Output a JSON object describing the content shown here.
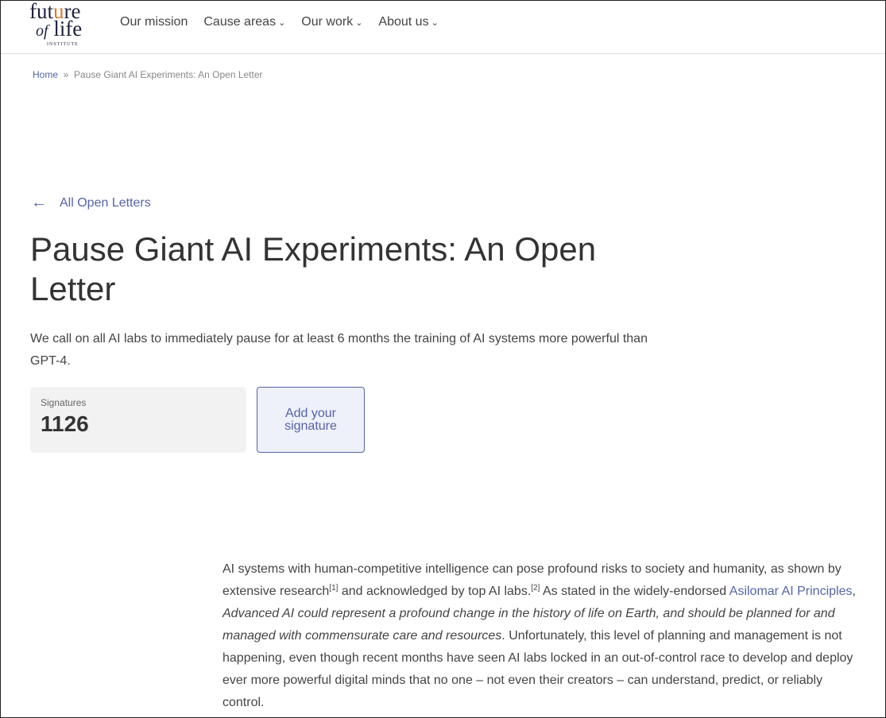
{
  "logo": {
    "line1": "future",
    "line2_of": "of",
    "line2": "life",
    "line3": "INSTITUTE"
  },
  "nav": {
    "items": [
      {
        "label": "Our mission"
      },
      {
        "label": "Cause areas",
        "dropdown": true
      },
      {
        "label": "Our work",
        "dropdown": true
      },
      {
        "label": "About us",
        "dropdown": true
      }
    ]
  },
  "breadcrumb": {
    "home": "Home",
    "sep": "»",
    "current": "Pause Giant AI Experiments: An Open Letter"
  },
  "back_link": "All Open Letters",
  "title": "Pause Giant AI Experiments: An Open Letter",
  "lead": "We call on all AI labs to immediately pause for at least 6 months the training of AI systems more powerful than GPT-4.",
  "signatures": {
    "label": "Signatures",
    "count": "1126"
  },
  "add_signature": "Add your signature",
  "body": {
    "p1a": "AI systems with human-competitive intelligence can pose profound risks to society and humanity, as shown by extensive research",
    "ref1": "[1]",
    "p1b": " and acknowledged by top AI labs.",
    "ref2": "[2]",
    "p1c": " As stated in the widely-endorsed ",
    "link": "Asilomar AI Principles",
    "p1d": ", ",
    "quote": "Advanced AI could represent a profound change in the history of life on Earth, and should be planned for and managed with commensurate care and resources",
    "p1e": ". Unfortunately, this level of planning and management is not happening, even though recent months have seen AI labs locked in an out-of-control race to develop and deploy ever more powerful digital minds that no one – not even their creators – can understand, predict, or reliably control."
  },
  "colors": {
    "accent": "#5564a8",
    "flame": "#e07a2e"
  }
}
